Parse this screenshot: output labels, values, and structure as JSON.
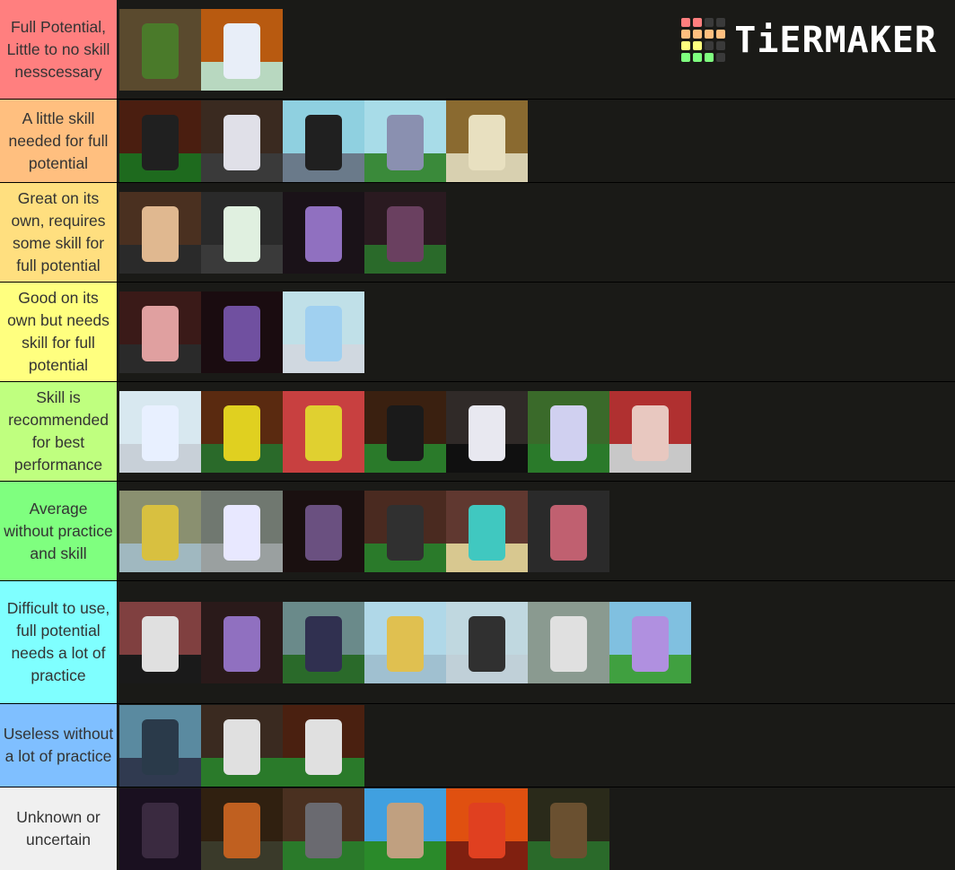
{
  "logo": {
    "text": "TiERMAKER",
    "grid_colors": [
      "#ff7f7f",
      "#ff7f7f",
      "#3a3a3a",
      "#3a3a3a",
      "#ffbf7f",
      "#ffbf7f",
      "#ffbf7f",
      "#ffbf7f",
      "#ffff7f",
      "#ffff7f",
      "#3a3a3a",
      "#3a3a3a",
      "#7fff7f",
      "#7fff7f",
      "#7fff7f",
      "#3a3a3a"
    ]
  },
  "tiers": [
    {
      "label": "Full Potential, Little to no skill nesscessary",
      "color": "#ff7f7f",
      "height": 110,
      "items": [
        [
          "#5a4a2e",
          "#4a7a2a",
          "#5a4a2e"
        ],
        [
          "#b85a10",
          "#e8eef8",
          "#b8d8c0"
        ]
      ]
    },
    {
      "label": "A little skill needed for full potential",
      "color": "#ffbf7f",
      "height": 92,
      "items": [
        [
          "#4a1e10",
          "#202020",
          "#1e6a1e"
        ],
        [
          "#3a2a20",
          "#e0e0e8",
          "#3a3a3a"
        ],
        [
          "#8fd0e0",
          "#202020",
          "#6a7a8a"
        ],
        [
          "#a8dce8",
          "#8a90b0",
          "#3a8a3a"
        ],
        [
          "#8a6a30",
          "#e8e0c0",
          "#d8d0b0"
        ]
      ]
    },
    {
      "label": "Great on its own, requires some skill for full potential",
      "color": "#ffdf7f",
      "height": 110,
      "items": [
        [
          "#4a3020",
          "#e0b890",
          "#2a2a2a"
        ],
        [
          "#2a2a2a",
          "#e0f0e0",
          "#3a3a3a"
        ],
        [
          "#1a1218",
          "#9070c0",
          "#1a1218"
        ],
        [
          "#2a1a20",
          "#6a4060",
          "#2a6a2a"
        ]
      ]
    },
    {
      "label": "Good on its own but needs skill for full potential",
      "color": "#ffff7f",
      "height": 110,
      "items": [
        [
          "#3a1a18",
          "#e0a0a0",
          "#2a2a2a"
        ],
        [
          "#1a0c10",
          "#7050a0",
          "#1a0c10"
        ],
        [
          "#c0e0e8",
          "#a0d0f0",
          "#d0d8e0"
        ]
      ]
    },
    {
      "label": "Skill is recommended for best performance",
      "color": "#bfff7f",
      "height": 110,
      "items": [
        [
          "#d8e8f0",
          "#e8f0ff",
          "#c8d0d8"
        ],
        [
          "#5a2a10",
          "#e0d020",
          "#2a6a2a"
        ],
        [
          "#c84040",
          "#e0d030",
          "#c84040"
        ],
        [
          "#3a2010",
          "#1a1a1a",
          "#2a7a2a"
        ],
        [
          "#302a28",
          "#e8e8f0",
          "#101010"
        ],
        [
          "#3a6a2a",
          "#d0d0f0",
          "#2a7a2a"
        ],
        [
          "#b03030",
          "#e8c8c0",
          "#c8c8c8"
        ]
      ]
    },
    {
      "label": "Average without practice and skill",
      "color": "#7fff7f",
      "height": 110,
      "items": [
        [
          "#8a9070",
          "#d8c040",
          "#a0b8c0"
        ],
        [
          "#707870",
          "#e8e8ff",
          "#9aa0a0"
        ],
        [
          "#1a1010",
          "#6a5080",
          "#1a1010"
        ],
        [
          "#4a2a20",
          "#303030",
          "#2a7a2a"
        ],
        [
          "#603830",
          "#40c8c0",
          "#d8c890"
        ],
        [
          "#2a2a2a",
          "#c06070",
          "#2a2a2a"
        ]
      ]
    },
    {
      "label": "Difficult to use, full potential needs a lot of practice",
      "color": "#7fffff",
      "height": 136,
      "items": [
        [
          "#804040",
          "#e0e0e0",
          "#1a1a1a"
        ],
        [
          "#2a1a1a",
          "#9070c0",
          "#2a1a1a"
        ],
        [
          "#6a8a8a",
          "#303050",
          "#2a6a2a"
        ],
        [
          "#b0d8e8",
          "#e0c050",
          "#a0c0d0"
        ],
        [
          "#c0d8e0",
          "#303030",
          "#c0d0d8"
        ],
        [
          "#8a9a90",
          "#e0e0e0",
          "#8a9a90"
        ],
        [
          "#80c0e0",
          "#b090e0",
          "#40a040"
        ]
      ]
    },
    {
      "label": "Useless without a lot of practice",
      "color": "#7fbfff",
      "height": 92,
      "items": [
        [
          "#5a8aa0",
          "#2a3a4a",
          "#303a50"
        ],
        [
          "#3a2a20",
          "#e0e0e0",
          "#2a7a2a"
        ],
        [
          "#4a2010",
          "#e0e0e0",
          "#2a7a2a"
        ]
      ]
    },
    {
      "label": "Unknown or uncertain",
      "color": "#f0f0f0",
      "height": 92,
      "items": [
        [
          "#1a1020",
          "#3a2a40",
          "#1a1020"
        ],
        [
          "#302010",
          "#c06020",
          "#3a3a2a"
        ],
        [
          "#4a3020",
          "#6a6a70",
          "#2a7a2a"
        ],
        [
          "#40a0e0",
          "#c0a080",
          "#2a8a2a"
        ],
        [
          "#e05010",
          "#e04020",
          "#802010"
        ],
        [
          "#2a2a1a",
          "#6a5030",
          "#2a6a2a"
        ]
      ]
    }
  ]
}
